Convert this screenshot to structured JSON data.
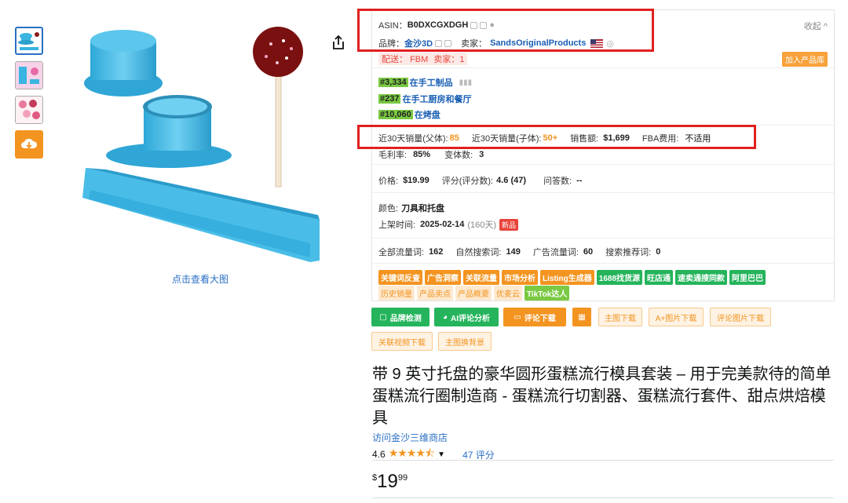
{
  "gallery": {
    "thumbnails": [
      "product-view-1",
      "product-view-2",
      "product-view-3"
    ],
    "download_icon": "cloud-download-icon",
    "zoom_text": "点击查看大图"
  },
  "panel": {
    "asin_label": "ASIN：",
    "asin_value": "B0DXCGXDGH",
    "collapse": "收起 ^",
    "brand_label": "品牌：",
    "brand_value": "金沙3D",
    "seller_label": "卖家：",
    "seller_value": "SandsOriginalProducts",
    "ship_label": "配送：",
    "ship_value": "FBM",
    "seller_count": "卖家：1",
    "add_library": "加入产品库",
    "ranks": [
      {
        "rank": "#3,334",
        "in": "在",
        "category": "手工制品"
      },
      {
        "rank": "#237",
        "in": "在",
        "category": "手工厨房和餐厅"
      },
      {
        "rank": "#10,060",
        "in": "在",
        "category": "烤盘"
      }
    ],
    "sales30_parent_label": "近30天销量(父体):",
    "sales30_parent_value": "85",
    "sales30_child_label": "近30天销量(子体):",
    "sales30_child_value": "50+",
    "revenue_label": "销售额:",
    "revenue_value": "$1,699",
    "fba_label": "FBA费用:",
    "fba_value": "不适用",
    "margin_label": "毛利率:",
    "margin_value": "85%",
    "variants_label": "变体数:",
    "variants_value": "3",
    "price_label": "价格:",
    "price_value": "$19.99",
    "score_label": "评分(评分数):",
    "score_value": "4.6 (47)",
    "qa_label": "问答数:",
    "qa_value": "--",
    "color_label": "颜色:",
    "color_value": "刀具和托盘",
    "listed_label": "上架时间:",
    "listed_value": "2025-02-14",
    "listed_days": "(160天)",
    "new_badge": "新品",
    "traffic_all_label": "全部流量词:",
    "traffic_all_value": "162",
    "organic_label": "自然搜索词:",
    "organic_value": "149",
    "ad_label": "广告流量词:",
    "ad_value": "60",
    "rec_label": "搜索推荐词:",
    "rec_value": "0",
    "tags_row1": [
      "关键词反查",
      "广告洞察",
      "关联流量",
      "市场分析",
      "Listing生成器",
      "1688找货源",
      "旺店通",
      "速卖通搜同款",
      "阿里巴巴"
    ],
    "tags_row2": [
      "历史销量",
      "产品卖点",
      "产品概要",
      "优麦云",
      "TikTok达人"
    ]
  },
  "buttons": {
    "brand_check": "品牌检测",
    "ai_review": "AI评论分析",
    "review_download": "评论下载",
    "main_img_download": "主图下载",
    "aplus_download": "A+图片下载",
    "review_img_download": "评论图片下载",
    "video_download": "关联视频下载",
    "replace_bg": "主图换背景"
  },
  "product": {
    "title": "带 9 英寸托盘的豪华圆形蛋糕流行模具套装 – 用于完美款待的简单蛋糕流行圈制造商 - 蛋糕流行切割器、蛋糕流行套件、甜点烘焙模具",
    "store": "访问金沙三维商店",
    "rating": "4.6",
    "stars": "★★★★⯪",
    "rating_count": "47 评分",
    "price_symbol": "$",
    "price_whole": "19",
    "price_fraction": "99"
  },
  "colors": {
    "accent": "#f39420",
    "green": "#25b45c",
    "link": "#2a6fc4",
    "highlight": "#e02020"
  }
}
